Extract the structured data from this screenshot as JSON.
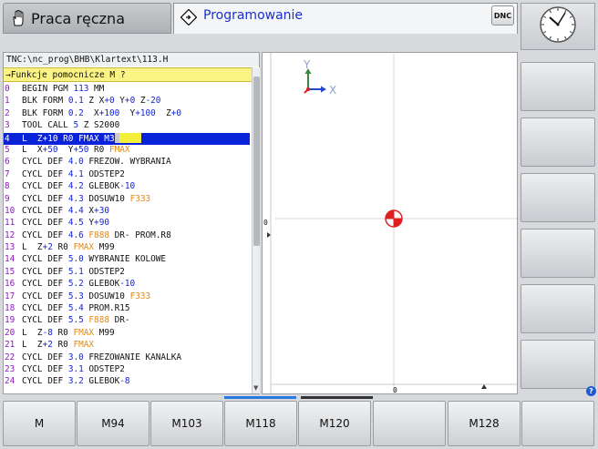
{
  "header": {
    "mode_tab_manual": "Praca ręczna",
    "mode_tab_programming": "Programowanie",
    "dnc_label": "DNC"
  },
  "program": {
    "path": "TNC:\\nc_prog\\BHB\\Klartext\\113.H",
    "status_line": "→Funkcje pomocnicze M ?",
    "lines": [
      [
        [
          "ln",
          "0"
        ],
        [
          "",
          "BEGIN PGM "
        ],
        [
          "num",
          "113"
        ],
        [
          "",
          " MM"
        ]
      ],
      [
        [
          "ln",
          "1"
        ],
        [
          "",
          "BLK FORM "
        ],
        [
          "num",
          "0.1"
        ],
        [
          "",
          " Z X"
        ],
        [
          "num",
          "+0"
        ],
        [
          "",
          " Y"
        ],
        [
          "num",
          "+0"
        ],
        [
          "",
          " Z"
        ],
        [
          "num",
          "-20"
        ]
      ],
      [
        [
          "ln",
          "2"
        ],
        [
          "",
          "BLK FORM "
        ],
        [
          "num",
          "0.2"
        ],
        [
          "",
          "  X"
        ],
        [
          "num",
          "+100"
        ],
        [
          "",
          "  Y"
        ],
        [
          "num",
          "+100"
        ],
        [
          "",
          "  Z"
        ],
        [
          "num",
          "+0"
        ]
      ],
      [
        [
          "ln",
          "3"
        ],
        [
          "",
          "TOOL CALL "
        ],
        [
          "num",
          "5"
        ],
        [
          "",
          " Z S2000"
        ]
      ],
      [
        [
          "ln",
          "4"
        ],
        [
          "",
          "L  Z+10 R0 FMAX M3"
        ]
      ],
      [
        [
          "ln",
          "5"
        ],
        [
          "",
          "L  X"
        ],
        [
          "num",
          "+50"
        ],
        [
          "",
          "  Y"
        ],
        [
          "num",
          "+50"
        ],
        [
          "",
          " R0 "
        ],
        [
          "orange",
          "FMAX"
        ]
      ],
      [
        [
          "ln",
          "6"
        ],
        [
          "",
          "CYCL DEF "
        ],
        [
          "num",
          "4.0"
        ],
        [
          "",
          " FREZOW. WYBRANIA"
        ]
      ],
      [
        [
          "ln",
          "7"
        ],
        [
          "",
          "CYCL DEF "
        ],
        [
          "num",
          "4.1"
        ],
        [
          "",
          " ODSTEP2"
        ]
      ],
      [
        [
          "ln",
          "8"
        ],
        [
          "",
          "CYCL DEF "
        ],
        [
          "num",
          "4.2"
        ],
        [
          "",
          " GLEBOK"
        ],
        [
          "num",
          "-10"
        ]
      ],
      [
        [
          "ln",
          "9"
        ],
        [
          "",
          "CYCL DEF "
        ],
        [
          "num",
          "4.3"
        ],
        [
          "",
          " DOSUW10 "
        ],
        [
          "orange",
          "F333"
        ]
      ],
      [
        [
          "ln",
          "10"
        ],
        [
          "",
          "CYCL DEF "
        ],
        [
          "num",
          "4.4"
        ],
        [
          "",
          " X"
        ],
        [
          "num",
          "+30"
        ]
      ],
      [
        [
          "ln",
          "11"
        ],
        [
          "",
          "CYCL DEF "
        ],
        [
          "num",
          "4.5"
        ],
        [
          "",
          " Y"
        ],
        [
          "num",
          "+90"
        ]
      ],
      [
        [
          "ln",
          "12"
        ],
        [
          "",
          "CYCL DEF "
        ],
        [
          "num",
          "4.6"
        ],
        [
          "",
          " "
        ],
        [
          "orange",
          "F888"
        ],
        [
          "",
          " DR- PROM.R8"
        ]
      ],
      [
        [
          "ln",
          "13"
        ],
        [
          "",
          "L  Z"
        ],
        [
          "num",
          "+2"
        ],
        [
          "",
          " R0 "
        ],
        [
          "orange",
          "FMAX"
        ],
        [
          "",
          " M99"
        ]
      ],
      [
        [
          "ln",
          "14"
        ],
        [
          "",
          "CYCL DEF "
        ],
        [
          "num",
          "5.0"
        ],
        [
          "",
          " WYBRANIE KOLOWE"
        ]
      ],
      [
        [
          "ln",
          "15"
        ],
        [
          "",
          "CYCL DEF "
        ],
        [
          "num",
          "5.1"
        ],
        [
          "",
          " ODSTEP2"
        ]
      ],
      [
        [
          "ln",
          "16"
        ],
        [
          "",
          "CYCL DEF "
        ],
        [
          "num",
          "5.2"
        ],
        [
          "",
          " GLEBOK"
        ],
        [
          "num",
          "-10"
        ]
      ],
      [
        [
          "ln",
          "17"
        ],
        [
          "",
          "CYCL DEF "
        ],
        [
          "num",
          "5.3"
        ],
        [
          "",
          " DOSUW10 "
        ],
        [
          "orange",
          "F333"
        ]
      ],
      [
        [
          "ln",
          "18"
        ],
        [
          "",
          "CYCL DEF "
        ],
        [
          "num",
          "5.4"
        ],
        [
          "",
          " PROM.R15"
        ]
      ],
      [
        [
          "ln",
          "19"
        ],
        [
          "",
          "CYCL DEF "
        ],
        [
          "num",
          "5.5"
        ],
        [
          "",
          " "
        ],
        [
          "orange",
          "F888"
        ],
        [
          "",
          " DR-"
        ]
      ],
      [
        [
          "ln",
          "20"
        ],
        [
          "",
          "L  Z"
        ],
        [
          "num",
          "-8"
        ],
        [
          "",
          " R0 "
        ],
        [
          "orange",
          "FMAX"
        ],
        [
          "",
          " M99"
        ]
      ],
      [
        [
          "ln",
          "21"
        ],
        [
          "",
          "L  Z"
        ],
        [
          "num",
          "+2"
        ],
        [
          "",
          " R0 "
        ],
        [
          "orange",
          "FMAX"
        ]
      ],
      [
        [
          "ln",
          "22"
        ],
        [
          "",
          "CYCL DEF "
        ],
        [
          "num",
          "3.0"
        ],
        [
          "",
          " FREZOWANIE KANALKA"
        ]
      ],
      [
        [
          "ln",
          "23"
        ],
        [
          "",
          "CYCL DEF "
        ],
        [
          "num",
          "3.1"
        ],
        [
          "",
          " ODSTEP2"
        ]
      ],
      [
        [
          "ln",
          "24"
        ],
        [
          "",
          "CYCL DEF "
        ],
        [
          "num",
          "3.2"
        ],
        [
          "",
          " GLEBOK"
        ],
        [
          "num",
          "-8"
        ]
      ]
    ],
    "selected_line": 4
  },
  "graphics": {
    "axis_x_label": "X",
    "axis_y_label": "Y",
    "ruler_left_zero": "0",
    "ruler_bottom_zero": "0"
  },
  "softkeys": {
    "bottom": [
      "M",
      "M94",
      "M103",
      "M118",
      "M120",
      "",
      "M128",
      ""
    ]
  },
  "info_badge": "?",
  "colors": {
    "selection": "#0a23d8",
    "line_number": "#8a1cbd",
    "numeric": "#1524d6",
    "feed": "#e58a17",
    "status_bar": "#fbf384"
  },
  "icons": {
    "manual_mode": "hand-icon",
    "programming_mode": "edit-diamond-icon",
    "clock": "clock-icon"
  }
}
